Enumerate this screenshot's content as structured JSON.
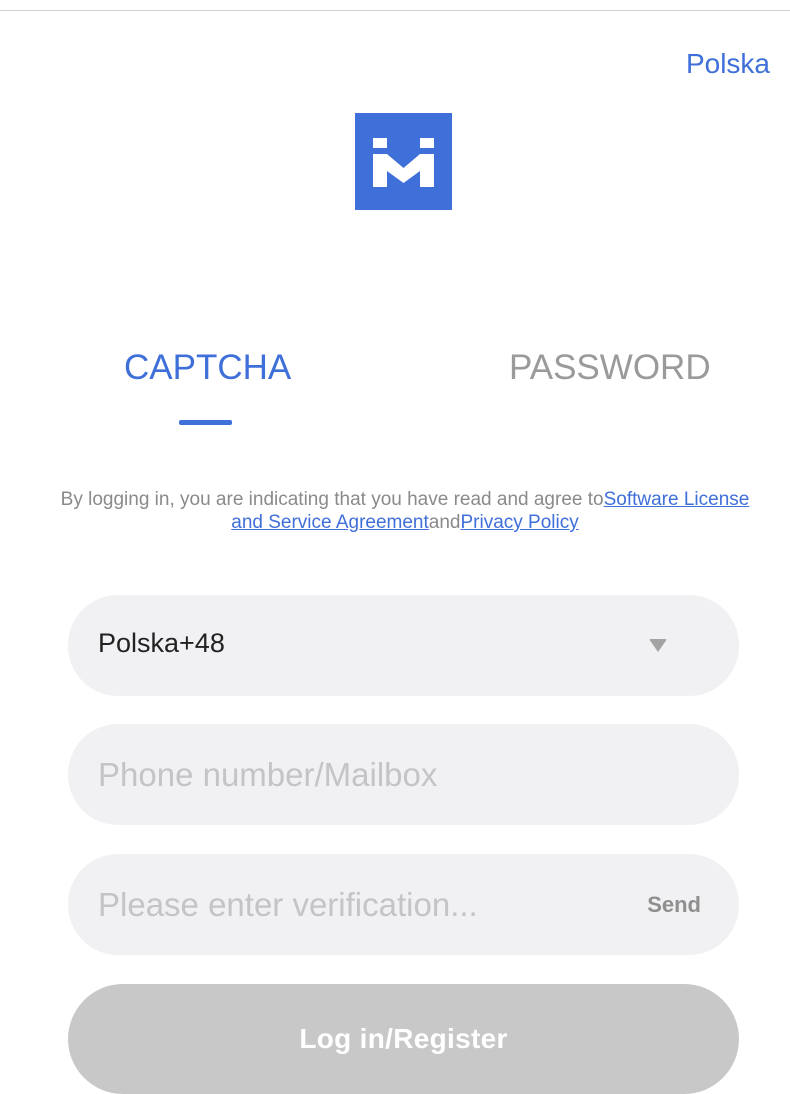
{
  "header": {
    "region_label": "Polska"
  },
  "logo": {
    "icon": "brand-logo-icon",
    "color": "#3f6fd8"
  },
  "tabs": [
    {
      "label": "CAPTCHA",
      "active": true
    },
    {
      "label": "PASSWORD",
      "active": false
    }
  ],
  "agreement": {
    "prefix": "By logging in, you are indicating that you have read and agree to",
    "license_link": "Software License and Service Agreement",
    "conjunction": "and",
    "privacy_link": "Privacy Policy"
  },
  "form": {
    "country_code": "Polska+48",
    "country_dropdown_icon": "caret-down-icon",
    "phone_placeholder": "Please enter verification...",
    "phone_value": "",
    "account_placeholder": "Phone number/Mailbox",
    "account_value": "",
    "code_placeholder": "Please enter verification...",
    "code_value": "",
    "send_label": "Send",
    "submit_label": "Log in/Register"
  },
  "colors": {
    "accent": "#3f6fd8",
    "inactive_tab": "#9a9a9a",
    "field_bg": "#f1f1f3",
    "button_disabled": "#c8c8c8"
  }
}
